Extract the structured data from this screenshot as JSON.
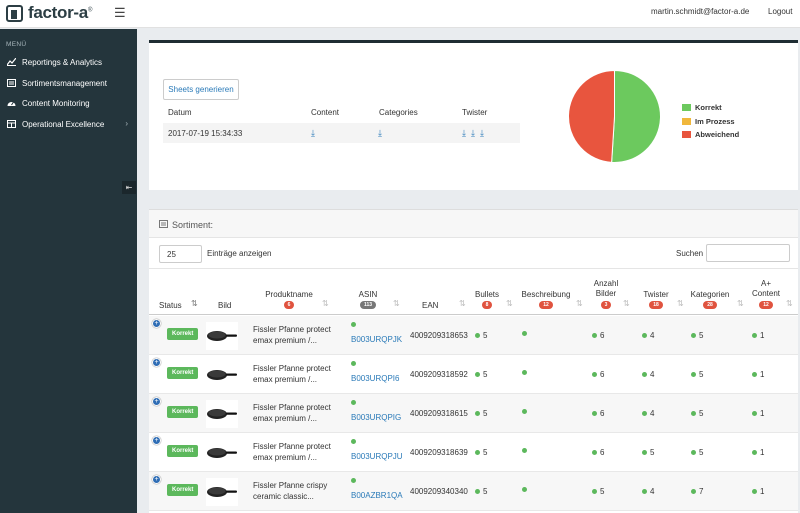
{
  "header": {
    "logo_text": "factor-a",
    "logo_reg": "®",
    "user_email": "martin.schmidt@factor-a.de",
    "logout_label": "Logout"
  },
  "sidebar": {
    "menu_label": "MENÜ",
    "items": [
      {
        "label": "Reportings & Analytics",
        "icon": "line-chart-icon"
      },
      {
        "label": "Sortimentsmanagement",
        "icon": "list-icon"
      },
      {
        "label": "Content Monitoring",
        "icon": "dashboard-icon"
      },
      {
        "label": "Operational Excellence",
        "icon": "table-icon",
        "has_submenu": true
      }
    ]
  },
  "sheets": {
    "button_label": "Sheets generieren",
    "columns": [
      "Datum",
      "Content",
      "Categories",
      "Twister"
    ],
    "row": {
      "date": "2017-07-19 15:34:33"
    }
  },
  "status_chart": {
    "legend": [
      "Korrekt",
      "Im Prozess",
      "Abweichend"
    ],
    "colors": {
      "korrekt": "#6cc95e",
      "im_prozess": "#f0b73c",
      "abweichend": "#e8553e"
    }
  },
  "chart_data": {
    "type": "pie",
    "categories": [
      "Korrekt",
      "Im Prozess",
      "Abweichend"
    ],
    "values": [
      51,
      0,
      49
    ]
  },
  "sortiment": {
    "title": "Sortiment:",
    "length_value": "25",
    "length_label": "Einträge anzeigen",
    "search_label": "Suchen",
    "columns": {
      "status": "Status",
      "bild": "Bild",
      "produktname": "Produktname",
      "produktname_badge": "6",
      "asin": "ASIN",
      "asin_badge": "113",
      "ean": "EAN",
      "bullets": "Bullets",
      "bullets_badge": "8",
      "beschreibung": "Beschreibung",
      "beschreibung_badge": "12",
      "anzahl_bilder_1": "Anzahl",
      "anzahl_bilder_2": "Bilder",
      "anzahl_bilder_badge": "3",
      "twister": "Twister",
      "twister_badge": "18",
      "kategorien": "Kategorien",
      "kategorien_badge": "28",
      "aplus_1": "A+",
      "aplus_2": "Content",
      "aplus_badge": "12"
    },
    "rows": [
      {
        "status": "Korrekt",
        "name1": "Fissler Pfanne protect",
        "name2": "emax premium /...",
        "asin": "B003URQPJK",
        "ean": "4009209318653",
        "bullets": "5",
        "bilder": "6",
        "twister": "4",
        "kategorien": "5",
        "aplus": "1"
      },
      {
        "status": "Korrekt",
        "name1": "Fissler Pfanne protect",
        "name2": "emax premium /...",
        "asin": "B003URQPI6",
        "ean": "4009209318592",
        "bullets": "5",
        "bilder": "6",
        "twister": "4",
        "kategorien": "5",
        "aplus": "1"
      },
      {
        "status": "Korrekt",
        "name1": "Fissler Pfanne protect",
        "name2": "emax premium /...",
        "asin": "B003URQPIG",
        "ean": "4009209318615",
        "bullets": "5",
        "bilder": "6",
        "twister": "4",
        "kategorien": "5",
        "aplus": "1"
      },
      {
        "status": "Korrekt",
        "name1": "Fissler Pfanne protect",
        "name2": "emax premium /...",
        "asin": "B003URQPJU",
        "ean": "4009209318639",
        "bullets": "5",
        "bilder": "6",
        "twister": "5",
        "kategorien": "5",
        "aplus": "1"
      },
      {
        "status": "Korrekt",
        "name1": "Fissler Pfanne crispy",
        "name2": "ceramic classic...",
        "asin": "B00AZBR1QA",
        "ean": "4009209340340",
        "bullets": "5",
        "bilder": "5",
        "twister": "4",
        "kategorien": "7",
        "aplus": "1"
      }
    ]
  }
}
